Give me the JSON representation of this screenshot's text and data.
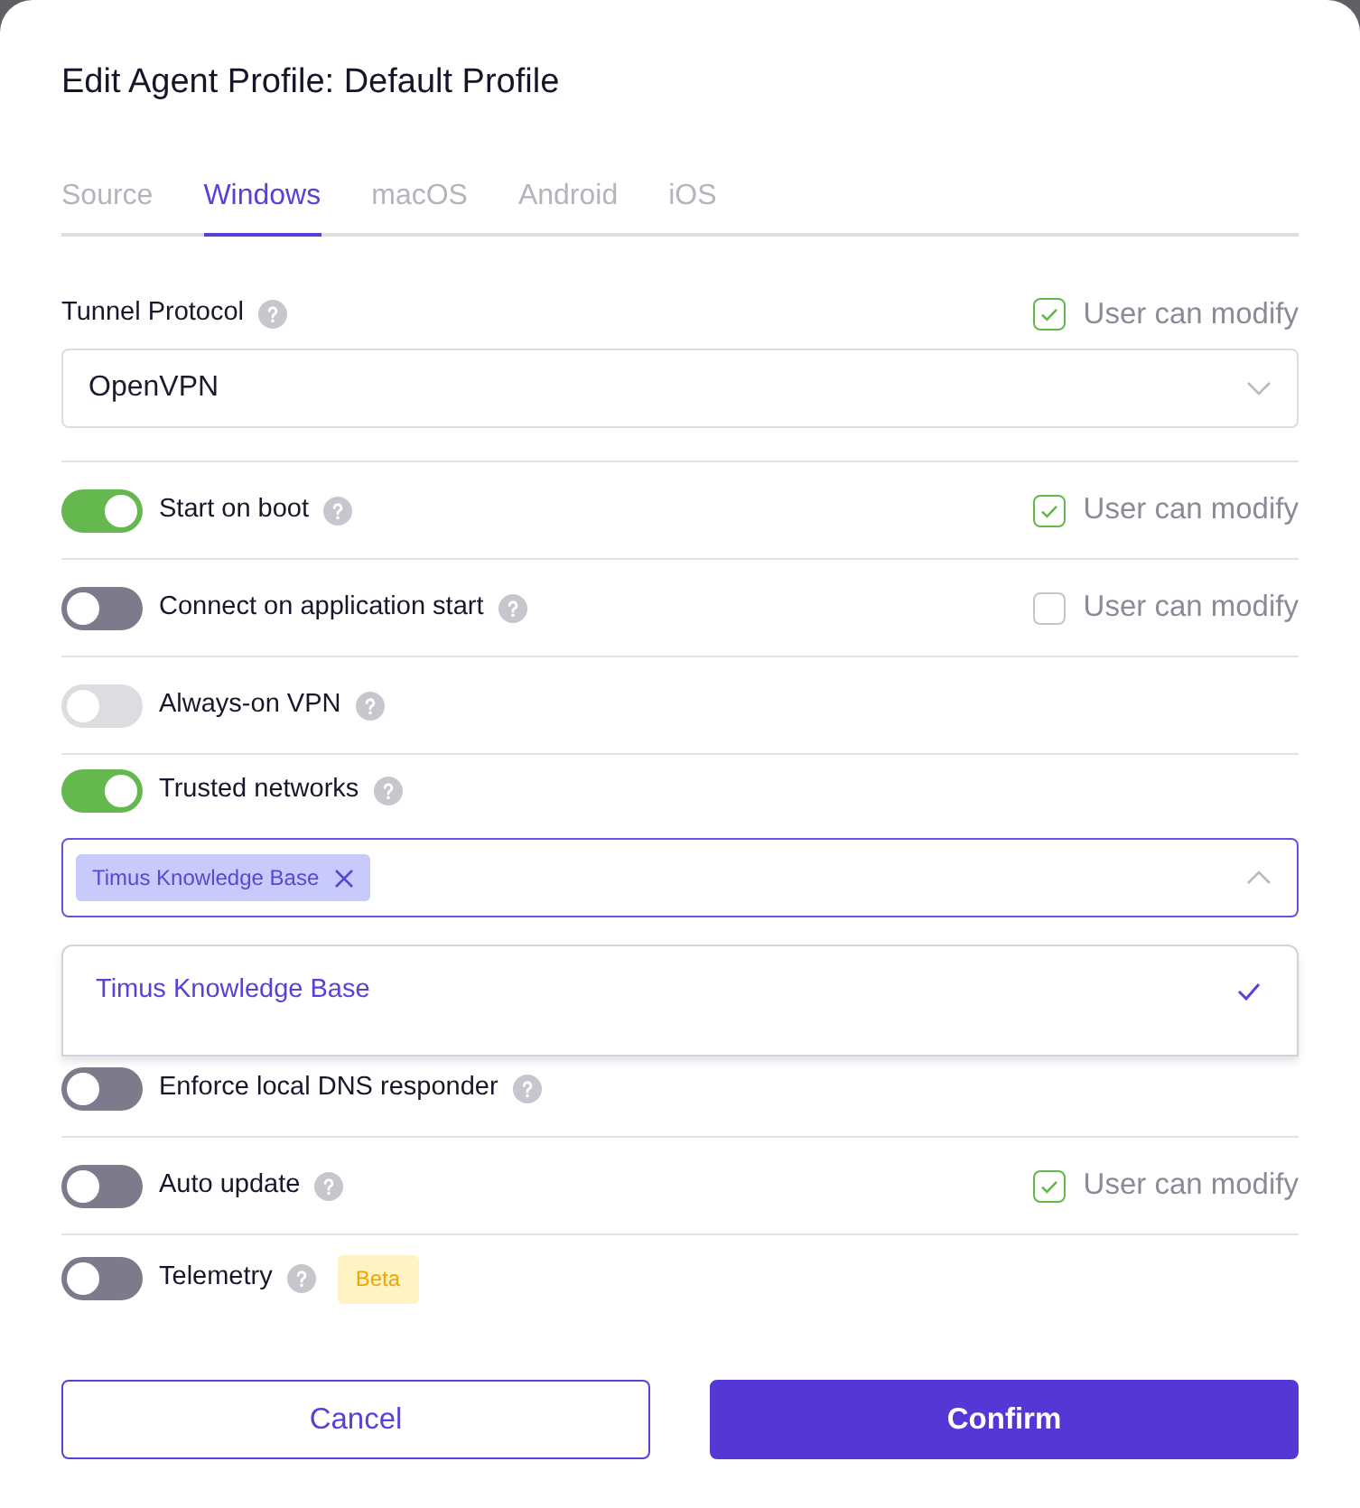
{
  "dialog": {
    "title": "Edit Agent Profile: Default Profile"
  },
  "tabs": [
    {
      "label": "Source",
      "selected": false
    },
    {
      "label": "Windows",
      "selected": true
    },
    {
      "label": "macOS",
      "selected": false
    },
    {
      "label": "Android",
      "selected": false
    },
    {
      "label": "iOS",
      "selected": false
    }
  ],
  "tunnel_protocol": {
    "label": "Tunnel Protocol",
    "user_can_modify": {
      "label": "User can modify",
      "checked": true
    },
    "value": "OpenVPN"
  },
  "settings": [
    {
      "kind": "toggle",
      "label": "Start on boot",
      "on": true,
      "disabled": false,
      "user_can_modify": {
        "label": "User can modify",
        "checked": true
      }
    },
    {
      "kind": "toggle",
      "label": "Connect on application start",
      "on": false,
      "disabled": false,
      "user_can_modify": {
        "label": "User can modify",
        "checked": false
      }
    },
    {
      "kind": "toggle",
      "label": "Always-on VPN",
      "on": false,
      "disabled": true
    },
    {
      "kind": "toggle_select",
      "label": "Trusted networks",
      "on": true,
      "disabled": false,
      "select": {
        "tags": [
          {
            "label": "Timus Knowledge Base"
          }
        ],
        "expanded": true,
        "options": [
          {
            "label": "Timus Knowledge Base",
            "selected": true
          }
        ]
      }
    },
    {
      "kind": "toggle",
      "label": "Enforce local DNS responder",
      "on": false,
      "disabled": false
    },
    {
      "kind": "toggle",
      "label": "Auto update",
      "on": false,
      "disabled": false,
      "user_can_modify": {
        "label": "User can modify",
        "checked": true
      }
    },
    {
      "kind": "toggle",
      "label": "Telemetry",
      "on": false,
      "disabled": false,
      "badge": "Beta"
    }
  ],
  "buttons": [
    {
      "kind": "secondary",
      "label": "Cancel"
    },
    {
      "kind": "primary",
      "label": "Confirm"
    }
  ]
}
